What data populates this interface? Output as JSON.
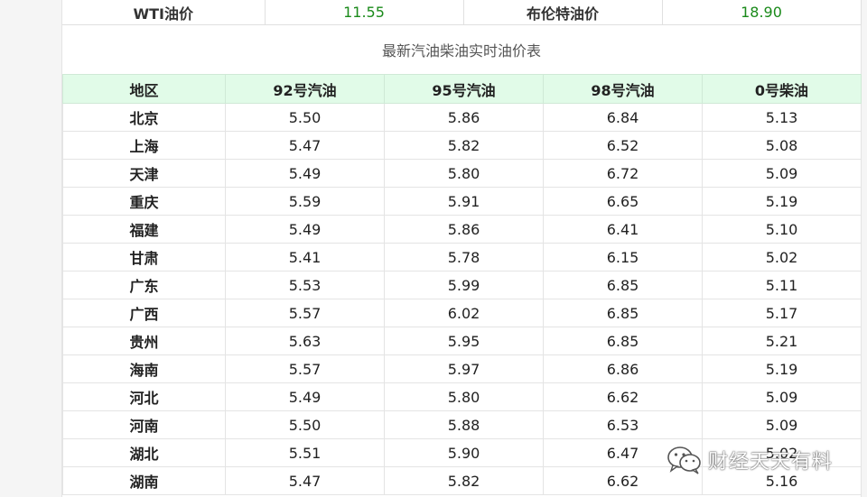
{
  "top_row": {
    "wti_label": "WTI油价",
    "wti_value": "11.55",
    "brent_label": "布伦特油价",
    "brent_value": "18.90"
  },
  "table_title": "最新汽油柴油实时油价表",
  "columns": [
    "地区",
    "92号汽油",
    "95号汽油",
    "98号汽油",
    "0号柴油"
  ],
  "rows": [
    [
      "北京",
      "5.50",
      "5.86",
      "6.84",
      "5.13"
    ],
    [
      "上海",
      "5.47",
      "5.82",
      "6.52",
      "5.08"
    ],
    [
      "天津",
      "5.49",
      "5.80",
      "6.72",
      "5.09"
    ],
    [
      "重庆",
      "5.59",
      "5.91",
      "6.65",
      "5.19"
    ],
    [
      "福建",
      "5.49",
      "5.86",
      "6.41",
      "5.10"
    ],
    [
      "甘肃",
      "5.41",
      "5.78",
      "6.15",
      "5.02"
    ],
    [
      "广东",
      "5.53",
      "5.99",
      "6.85",
      "5.11"
    ],
    [
      "广西",
      "5.57",
      "6.02",
      "6.85",
      "5.17"
    ],
    [
      "贵州",
      "5.63",
      "5.95",
      "6.85",
      "5.21"
    ],
    [
      "海南",
      "5.57",
      "5.97",
      "6.86",
      "5.19"
    ],
    [
      "河北",
      "5.49",
      "5.80",
      "6.62",
      "5.09"
    ],
    [
      "河南",
      "5.50",
      "5.88",
      "6.53",
      "5.09"
    ],
    [
      "湖北",
      "5.51",
      "5.90",
      "6.47",
      "5.02"
    ],
    [
      "湖南",
      "5.47",
      "5.82",
      "6.62",
      "5.16"
    ]
  ],
  "watermark": {
    "text": "财经天天有料",
    "icon": "wechat-icon"
  },
  "colors": {
    "header_bg": "#e1fbe8",
    "price_green": "#1a8a1a"
  }
}
